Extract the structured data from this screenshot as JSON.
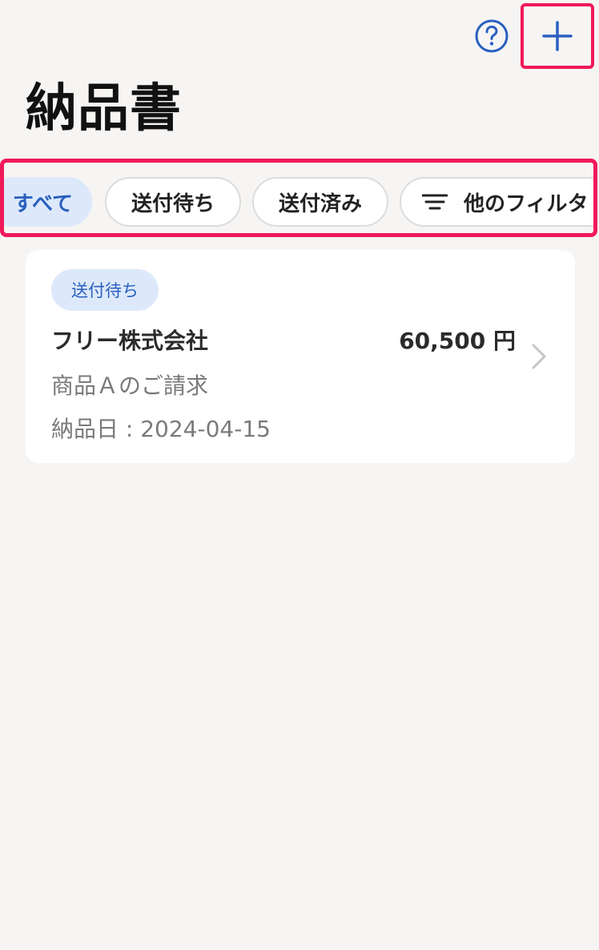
{
  "header": {
    "title": "納品書",
    "help_icon": "question-circle-icon",
    "add_icon": "plus-icon"
  },
  "filters": {
    "all": "すべて",
    "pending": "送付待ち",
    "sent": "送付済み",
    "more": "他のフィルタ",
    "more_icon": "filter-lines-icon",
    "selected": "all"
  },
  "invoices": [
    {
      "status": "送付待ち",
      "customer": "フリー株式会社",
      "amount": "60,500 円",
      "description": "商品Ａのご請求",
      "delivery_date": "納品日 : 2024-04-15"
    }
  ],
  "colors": {
    "accent": "#2a5fc0",
    "accent_bg": "#dde9fb",
    "highlight": "#f0195a",
    "background": "#f6f5f4"
  }
}
